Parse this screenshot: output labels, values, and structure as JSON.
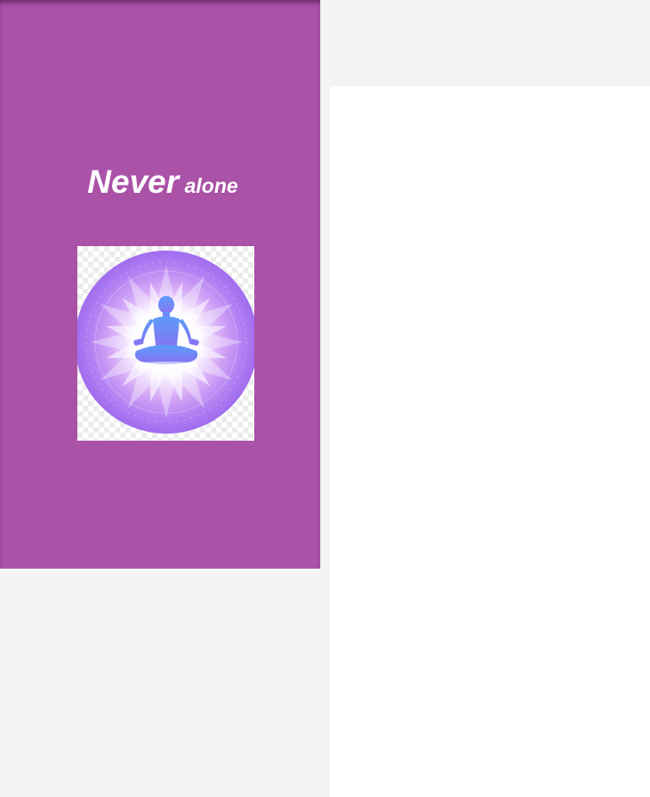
{
  "splash": {
    "title_main": "Never",
    "title_sub": "alone",
    "background_color": "#aa52a8",
    "logo": {
      "icon": "meditation-lotus-icon",
      "colors": {
        "ring": "#a46ef0",
        "figure": "#6f8cf8"
      }
    }
  },
  "page": {
    "background_color": "#f4f4f4",
    "panel_color": "#ffffff"
  }
}
